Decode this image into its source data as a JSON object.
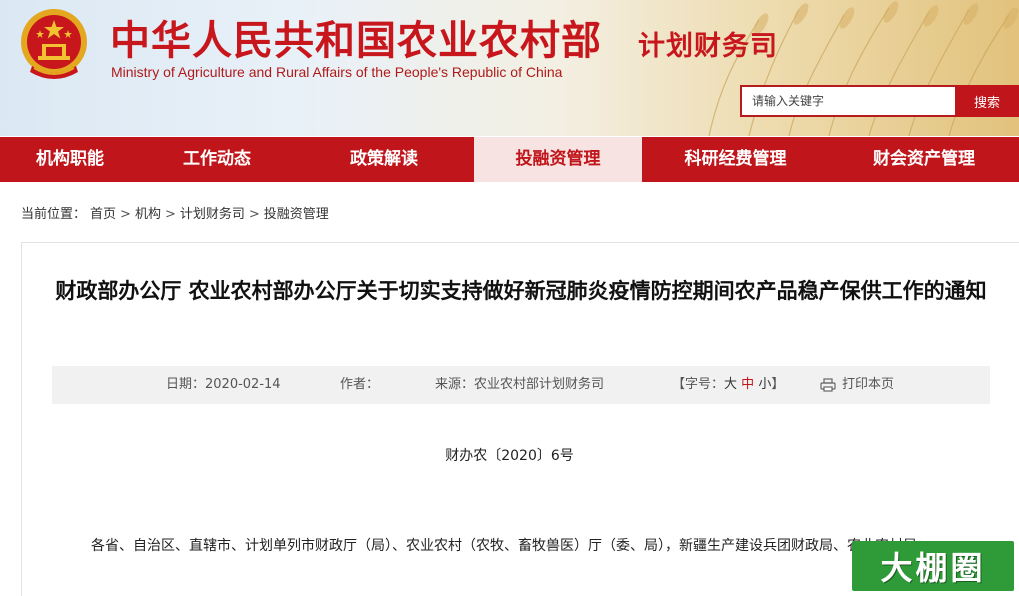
{
  "header": {
    "site_title_cn": "中华人民共和国农业农村部",
    "site_title_en": "Ministry of Agriculture and Rural Affairs of the People's Republic of China",
    "dept_name": "计划财务司",
    "search_placeholder": "请输入关键字",
    "search_button": "搜索"
  },
  "nav": {
    "items": [
      {
        "label": "机构职能"
      },
      {
        "label": "工作动态"
      },
      {
        "label": "政策解读"
      },
      {
        "label": "投融资管理"
      },
      {
        "label": "科研经费管理"
      },
      {
        "label": "财会资产管理"
      }
    ],
    "active_index": 3
  },
  "breadcrumb": {
    "prefix": "当前位置：",
    "items": [
      "首页",
      "机构",
      "计划财务司",
      "投融资管理"
    ],
    "separator": ">"
  },
  "article": {
    "title": "财政部办公厅 农业农村部办公厅关于切实支持做好新冠肺炎疫情防控期间农产品稳产保供工作的通知",
    "meta": {
      "date": "日期：2020-02-14",
      "author": "作者：",
      "source": "来源：农业农村部计划财务司",
      "fontsize_prefix": "【字号：",
      "fontsize_large": "大",
      "fontsize_medium": "中",
      "fontsize_small": "小",
      "fontsize_suffix": "】",
      "print": "打印本页"
    },
    "doc_number": "财办农〔2020〕6号",
    "paragraph": "各省、自治区、直辖市、计划单列市财政厅（局）、农业农村（农牧、畜牧兽医）厅（委、局），新疆生产建设兵团财政局、农业农村局："
  },
  "watermark": {
    "text": "大棚圈"
  },
  "colors": {
    "brand_red": "#c0161b",
    "nav_active_bg": "#f7e3e1",
    "meta_bg": "#f1f1f1",
    "watermark_green": "#2f9a38"
  }
}
